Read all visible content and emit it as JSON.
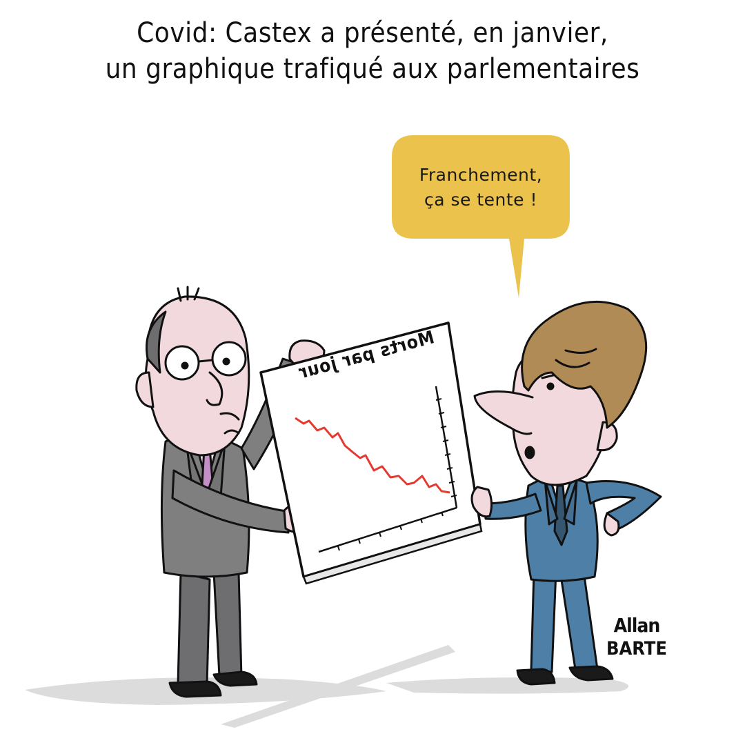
{
  "headline": {
    "line1": "Covid: Castex a présenté, en janvier,",
    "line2": "un graphique trafiqué aux parlementaires"
  },
  "speech_bubble": {
    "line1": "Franchement,",
    "line2": "ça se tente !",
    "color": "#ebc24b"
  },
  "held_chart": {
    "label": "Morts par jour",
    "line_color": "#e53a31"
  },
  "signature": {
    "line1": "Allan",
    "line2": "BARTE"
  },
  "colors": {
    "left_suit": "#7f7f80",
    "right_suit": "#4e7fa6",
    "hair": "#b08b55",
    "skin": "#f2d9de"
  }
}
